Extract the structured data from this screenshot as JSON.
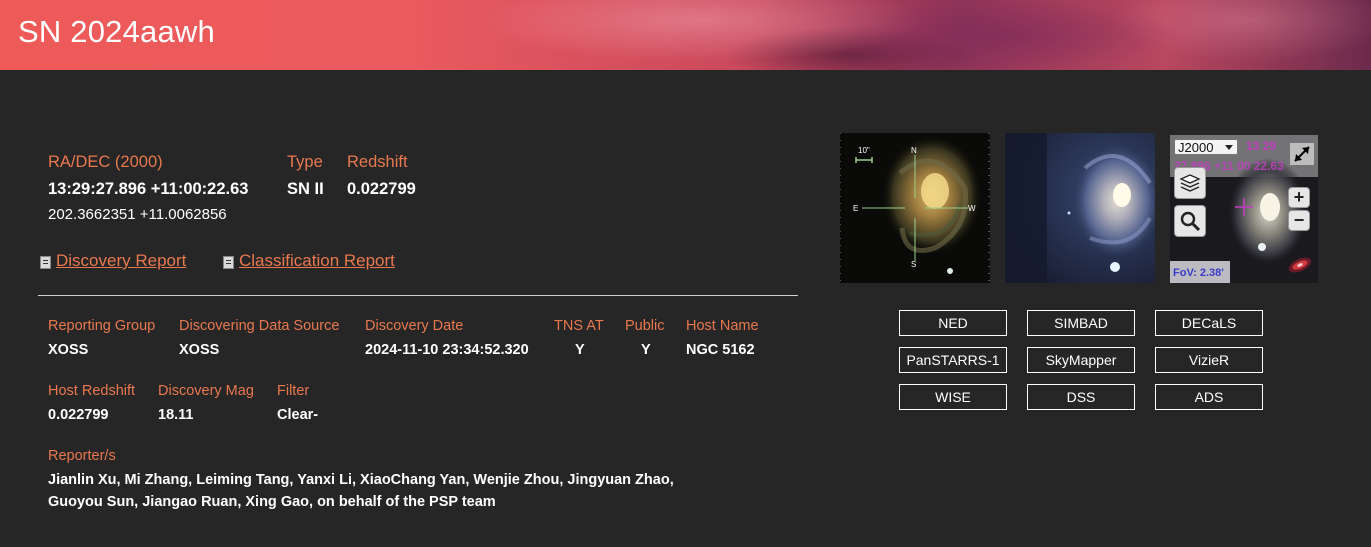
{
  "page": {
    "title": "SN 2024aawh"
  },
  "coords": {
    "label": "RA/DEC (2000)",
    "sexagesimal": "13:29:27.896 +11:00:22.63",
    "decimal": "202.3662351 +11.0062856"
  },
  "type": {
    "label": "Type",
    "value": "SN II"
  },
  "redshift": {
    "label": "Redshift",
    "value": "0.022799"
  },
  "reports": {
    "discovery": "Discovery Report",
    "classification": "Classification Report"
  },
  "details_row1": [
    {
      "label": "Reporting Group",
      "value": "XOSS"
    },
    {
      "label": "Discovering Data Source",
      "value": "XOSS"
    },
    {
      "label": "Discovery Date",
      "value": "2024-11-10 23:34:52.320"
    },
    {
      "label": "TNS AT",
      "value": "Y"
    },
    {
      "label": "Public",
      "value": "Y"
    },
    {
      "label": "Host Name",
      "value": "NGC 5162"
    }
  ],
  "details_row2": [
    {
      "label": "Host Redshift",
      "value": "0.022799"
    },
    {
      "label": "Discovery Mag",
      "value": "18.11"
    },
    {
      "label": "Filter",
      "value": "Clear-"
    }
  ],
  "reporters": {
    "label": "Reporter/s",
    "line1": "Jianlin Xu, Mi Zhang, Leiming Tang, Yanxi Li, XiaoChang Yan, Wenjie Zhou, Jingyuan Zhao,",
    "line2": "Guoyou Sun, Jiangao Ruan, Xing Gao, on behalf of the PSP team"
  },
  "finder_chart": {
    "scale_label": "10\"",
    "compass": {
      "north": "N",
      "south": "S",
      "east": "E",
      "west": "W"
    }
  },
  "aladin": {
    "frame": "J2000",
    "coord_line1": "13 29",
    "coord_line2": "27.896 +11 00 22.63",
    "fov": "FoV: 2.38'",
    "zoom_in": "+",
    "zoom_out": "−"
  },
  "external_links": [
    "NED",
    "SIMBAD",
    "DECaLS",
    "PanSTARRS-1",
    "SkyMapper",
    "VizieR",
    "WISE",
    "DSS",
    "ADS"
  ],
  "colors": {
    "accent": "#e9784f",
    "background": "#262626",
    "aladin_text": "#c23fc2"
  }
}
